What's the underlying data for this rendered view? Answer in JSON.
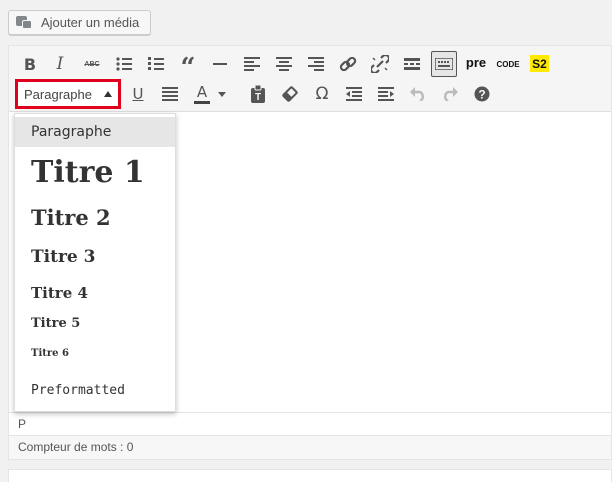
{
  "media": {
    "add_media_label": "Ajouter un média"
  },
  "toolbar": {
    "row1": [
      {
        "name": "bold-button",
        "label": "B"
      },
      {
        "name": "italic-button",
        "label": "I"
      },
      {
        "name": "strikethrough-button",
        "label": "ABC"
      },
      {
        "name": "bullet-list-button",
        "label": ""
      },
      {
        "name": "numbered-list-button",
        "label": ""
      },
      {
        "name": "blockquote-button",
        "label": "“"
      },
      {
        "name": "horizontal-rule-button",
        "label": ""
      },
      {
        "name": "align-left-button",
        "label": ""
      },
      {
        "name": "align-center-button",
        "label": ""
      },
      {
        "name": "align-right-button",
        "label": ""
      },
      {
        "name": "insert-link-button",
        "label": ""
      },
      {
        "name": "remove-link-button",
        "label": ""
      },
      {
        "name": "read-more-button",
        "label": ""
      },
      {
        "name": "toolbar-toggle-button",
        "label": ""
      },
      {
        "name": "pre-button",
        "label": "pre"
      },
      {
        "name": "code-button",
        "label": "CODE"
      },
      {
        "name": "s2-button",
        "label": "S2"
      }
    ],
    "row2": [
      {
        "name": "underline-button",
        "label": "U"
      },
      {
        "name": "justify-button",
        "label": ""
      },
      {
        "name": "text-color-button",
        "label": "A"
      },
      {
        "name": "text-color-dropdown-button",
        "label": ""
      },
      {
        "name": "paste-as-text-button",
        "label": ""
      },
      {
        "name": "clear-formatting-button",
        "label": ""
      },
      {
        "name": "special-character-button",
        "label": "Ω"
      },
      {
        "name": "outdent-button",
        "label": ""
      },
      {
        "name": "indent-button",
        "label": ""
      },
      {
        "name": "undo-button",
        "label": ""
      },
      {
        "name": "redo-button",
        "label": ""
      },
      {
        "name": "help-button",
        "label": ""
      }
    ],
    "format_select": {
      "value": "Paragraphe"
    }
  },
  "dropdown": {
    "items": [
      {
        "label": "Paragraphe",
        "selected": true
      },
      {
        "label": "Titre 1"
      },
      {
        "label": "Titre 2"
      },
      {
        "label": "Titre 3"
      },
      {
        "label": "Titre 4"
      },
      {
        "label": "Titre 5"
      },
      {
        "label": "Titre 6"
      },
      {
        "label": "Preformatted"
      }
    ]
  },
  "path": {
    "text": "P"
  },
  "status": {
    "word_count": "Compteur de mots : 0"
  },
  "colors": {
    "highlight_red": "#e0001b",
    "s2_yellow": "#ffea00"
  }
}
